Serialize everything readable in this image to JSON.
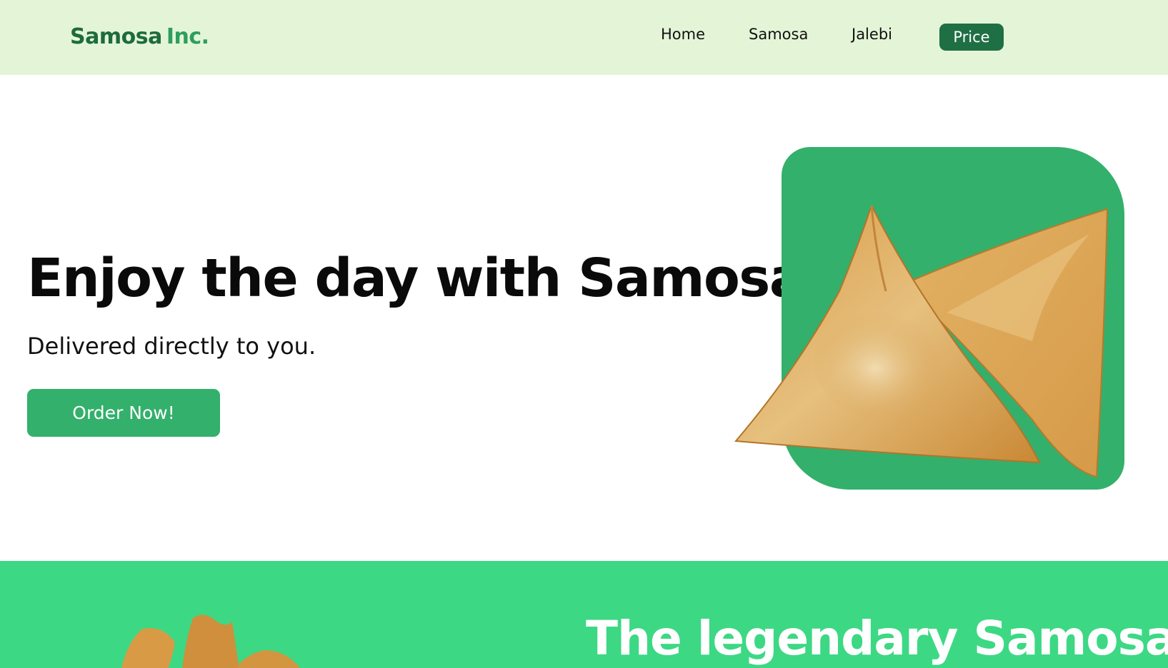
{
  "brand": {
    "name_part1": "Samosa",
    "name_part2": "Inc."
  },
  "nav": {
    "home": "Home",
    "samosa": "Samosa",
    "jalebi": "Jalebi",
    "price": "Price"
  },
  "hero": {
    "title": "Enjoy the day with Samosa",
    "subtitle": "Delivered directly to you.",
    "cta": "Order Now!",
    "image_icon": "samosa-image"
  },
  "legend": {
    "title": "The legendary Samosa",
    "image_icon": "samosa-image"
  },
  "colors": {
    "nav_bg": "#e4f5d7",
    "brand_dark": "#1e6b3c",
    "brand_light": "#2e9e5e",
    "price_btn": "#1f6f45",
    "accent": "#33b06c",
    "band": "#3dd884"
  }
}
